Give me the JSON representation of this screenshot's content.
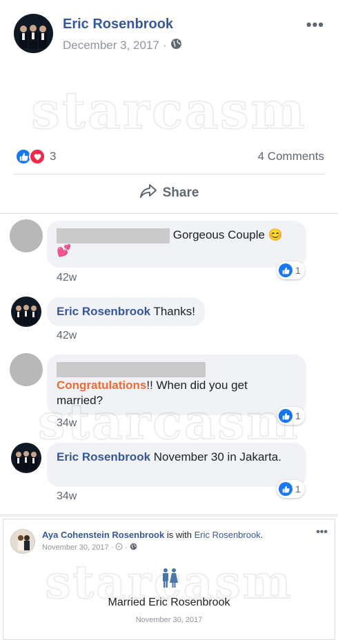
{
  "post": {
    "author": "Eric Rosenbrook",
    "date": "December 3, 2017",
    "date_separator": "·",
    "more": "•••",
    "watermark": "starcasm",
    "reaction_count": "3",
    "comments_count": "4 Comments",
    "share_label": "Share"
  },
  "comments": [
    {
      "text": "Gorgeous Couple",
      "emoji": "😊💕",
      "time": "42w",
      "likes": "1"
    },
    {
      "author": "Eric Rosenbrook",
      "text": "Thanks!",
      "time": "42w"
    },
    {
      "highlight": "Congratulations",
      "text": "!! When did you get married?",
      "time": "34w",
      "likes": "1"
    },
    {
      "author": "Eric Rosenbrook",
      "text": "November 30 in Jakarta.",
      "time": "34w",
      "likes": "1"
    }
  ],
  "embed": {
    "author": "Aya Cohenstein Rosenbrook",
    "with_text": "is with",
    "with_name": "Eric Rosenbrook",
    "period": ".",
    "date": "November 30, 2017",
    "date_separator": "·",
    "more": "•••",
    "event_text": "Married Eric Rosenbrook",
    "event_date": "November 30, 2017",
    "watermark": "starcasm"
  },
  "colors": {
    "link": "#365899",
    "like": "#1877f2",
    "love": "#f0284a",
    "highlight": "#f06a35"
  }
}
